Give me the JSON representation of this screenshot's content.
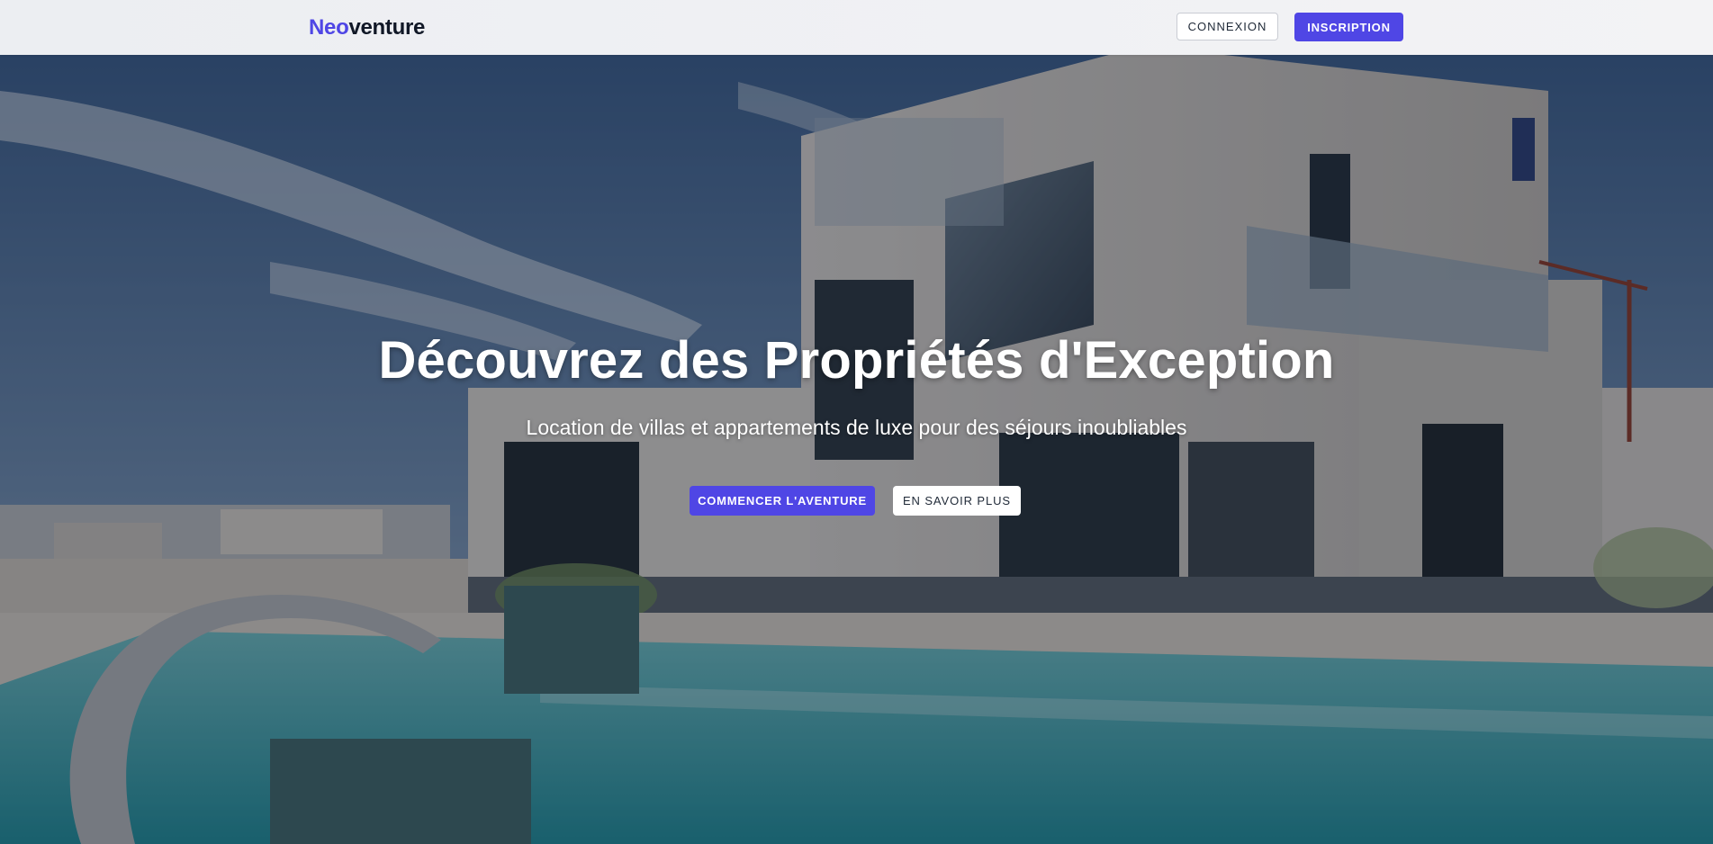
{
  "brand": {
    "part1": "Neo",
    "part2": "venture",
    "accent_color": "#4f46e5"
  },
  "nav": {
    "login_label": "CONNEXION",
    "signup_label": "INSCRIPTION"
  },
  "hero": {
    "title": "Découvrez des Propriétés d'Exception",
    "subtitle": "Location de villas et appartements de luxe pour des séjours inoubliables",
    "primary_cta": "COMMENCER L'AVENTURE",
    "secondary_cta": "EN SAVOIR PLUS"
  }
}
